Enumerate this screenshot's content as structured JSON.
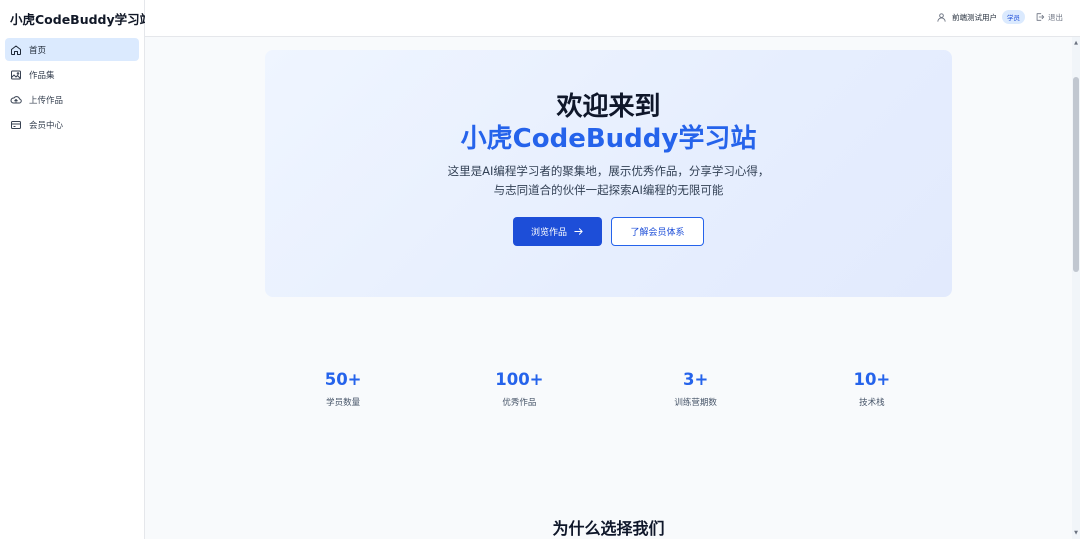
{
  "brand": "小虎CodeBuddy学习站",
  "nav": [
    {
      "label": "首页",
      "icon": "home-icon"
    },
    {
      "label": "作品集",
      "icon": "image-icon"
    },
    {
      "label": "上传作品",
      "icon": "cloud-upload-icon"
    },
    {
      "label": "会员中心",
      "icon": "credit-card-icon"
    }
  ],
  "header": {
    "user_name": "前端测试用户",
    "role_badge": "学员",
    "logout": "退出"
  },
  "hero": {
    "title_line1": "欢迎来到",
    "title_line2": "小虎CodeBuddy学习站",
    "desc_line1": "这里是AI编程学习者的聚集地，展示优秀作品，分享学习心得，",
    "desc_line2": "与志同道合的伙伴一起探索AI编程的无限可能",
    "primary_button": "浏览作品",
    "secondary_button": "了解会员体系"
  },
  "stats": [
    {
      "value": "50+",
      "label": "学员数量"
    },
    {
      "value": "100+",
      "label": "优秀作品"
    },
    {
      "value": "3+",
      "label": "训练营期数"
    },
    {
      "value": "10+",
      "label": "技术栈"
    }
  ],
  "section_title": "为什么选择我们",
  "colors": {
    "accent": "#2563eb",
    "primary_button": "#1d4ed8",
    "active_nav_bg": "#dbeafe"
  }
}
